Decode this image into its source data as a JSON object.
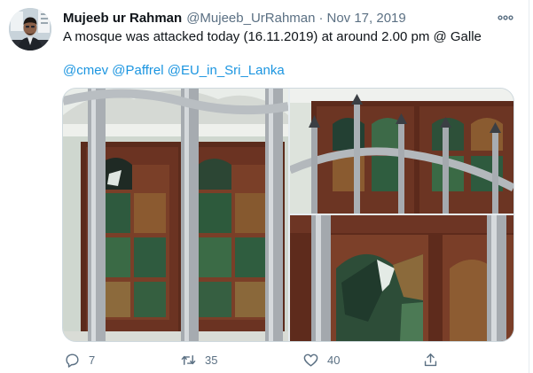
{
  "tweet": {
    "display_name": "Mujeeb ur Rahman",
    "handle": "@Mujeeb_UrRahman",
    "separator": "·",
    "date": "Nov 17, 2019",
    "text": "A mosque was attacked today (16.11.2019) at around 2.00 pm @ Galle",
    "mentions": [
      "@cmev",
      "@Paffrel",
      "@EU_in_Sri_Lanka"
    ]
  },
  "actions": {
    "replies": "7",
    "retweets": "35",
    "likes": "40"
  },
  "icons": {
    "more": "more-horizontal-icon",
    "reply": "reply-icon",
    "retweet": "retweet-icon",
    "like": "heart-icon",
    "share": "share-icon"
  },
  "colors": {
    "link": "#1b95e0",
    "secondary_text": "#5b7083",
    "border": "#cfd9de"
  }
}
